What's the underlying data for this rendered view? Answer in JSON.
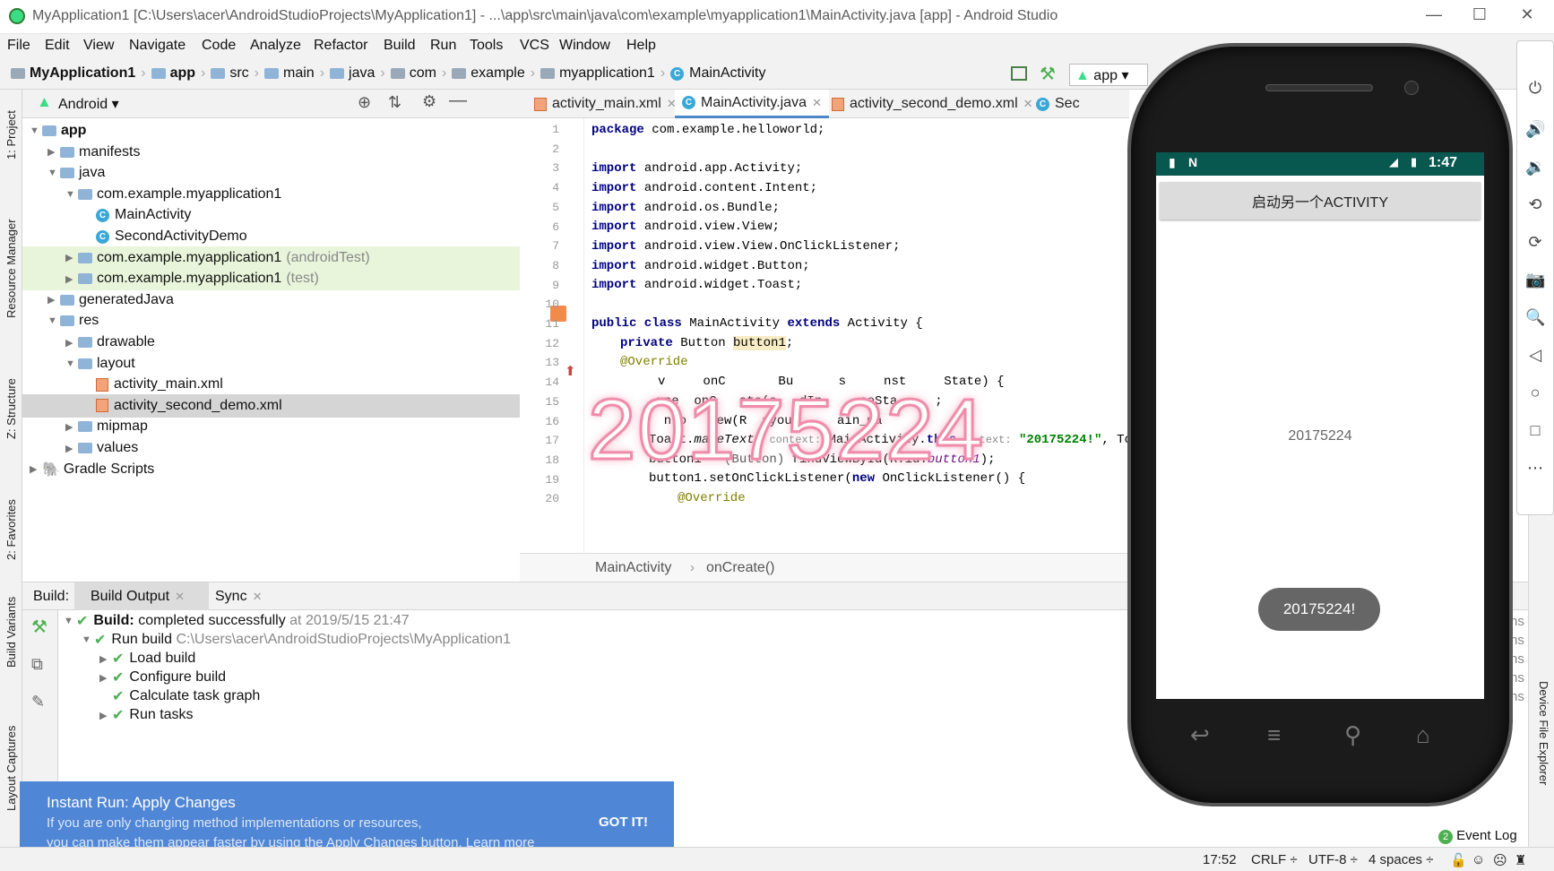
{
  "window": {
    "title": "MyApplication1 [C:\\Users\\acer\\AndroidStudioProjects\\MyApplication1] - ...\\app\\src\\main\\java\\com\\example\\myapplication1\\MainActivity.java [app] - Android Studio",
    "minimize": "—",
    "maximize": "☐",
    "close": "✕"
  },
  "menu": [
    "File",
    "Edit",
    "View",
    "Navigate",
    "Code",
    "Analyze",
    "Refactor",
    "Build",
    "Run",
    "Tools",
    "VCS",
    "Window",
    "Help"
  ],
  "breadcrumb": [
    "MyApplication1",
    "app",
    "src",
    "main",
    "java",
    "com",
    "example",
    "myapplication1",
    "MainActivity"
  ],
  "toolbar": {
    "run_config": "app"
  },
  "left_strip": [
    "1: Project",
    "Resource Manager",
    "Z: Structure",
    "2: Favorites",
    "Build Variants",
    "Layout Captures"
  ],
  "project": {
    "view_selector": "Android",
    "tree": [
      {
        "label": "app",
        "indent": 0,
        "arrow": "▼",
        "bold": true,
        "icon": "folder"
      },
      {
        "label": "manifests",
        "indent": 1,
        "arrow": "▶",
        "icon": "folder"
      },
      {
        "label": "java",
        "indent": 1,
        "arrow": "▼",
        "icon": "folder"
      },
      {
        "label": "com.example.myapplication1",
        "indent": 2,
        "arrow": "▼",
        "icon": "folder"
      },
      {
        "label": "MainActivity",
        "indent": 3,
        "arrow": "",
        "icon": "class"
      },
      {
        "label": "SecondActivityDemo",
        "indent": 3,
        "arrow": "",
        "icon": "class"
      },
      {
        "label": "com.example.myapplication1",
        "suffix": "(androidTest)",
        "indent": 2,
        "arrow": "▶",
        "icon": "folder",
        "hl": "green"
      },
      {
        "label": "com.example.myapplication1",
        "suffix": "(test)",
        "indent": 2,
        "arrow": "▶",
        "icon": "folder",
        "hl": "green"
      },
      {
        "label": "generatedJava",
        "indent": 1,
        "arrow": "▶",
        "icon": "folder"
      },
      {
        "label": "res",
        "indent": 1,
        "arrow": "▼",
        "icon": "folder"
      },
      {
        "label": "drawable",
        "indent": 2,
        "arrow": "▶",
        "icon": "folder"
      },
      {
        "label": "layout",
        "indent": 2,
        "arrow": "▼",
        "icon": "folder"
      },
      {
        "label": "activity_main.xml",
        "indent": 3,
        "arrow": "",
        "icon": "xml"
      },
      {
        "label": "activity_second_demo.xml",
        "indent": 3,
        "arrow": "",
        "icon": "xml",
        "hl": "sel"
      },
      {
        "label": "mipmap",
        "indent": 2,
        "arrow": "▶",
        "icon": "folder"
      },
      {
        "label": "values",
        "indent": 2,
        "arrow": "▶",
        "icon": "folder"
      },
      {
        "label": "Gradle Scripts",
        "indent": 0,
        "arrow": "▶",
        "icon": "gradle"
      }
    ]
  },
  "editor": {
    "tabs": [
      "activity_main.xml",
      "MainActivity.java",
      "activity_second_demo.xml",
      "Sec"
    ],
    "line_numbers": [
      "1",
      "2",
      "3",
      "4",
      "5",
      "6",
      "7",
      "8",
      "9",
      "10",
      "11",
      "12",
      "13",
      "14",
      "15",
      "16",
      "17",
      "18",
      "19",
      "20"
    ],
    "footer": {
      "class": "MainActivity",
      "method": "onCreate()"
    }
  },
  "code": {
    "l1_kw": "package",
    "l1": " com.example.helloworld;",
    "imp": "import",
    "l3": " android.app.Activity;",
    "l4": " android.content.Intent;",
    "l5": " android.os.Bundle;",
    "l6": " android.view.View;",
    "l7": " android.view.View.OnClickListener;",
    "l8": " android.widget.Button;",
    "l9": " android.widget.Toast;",
    "l11_a": "public class",
    "l11_b": " MainActivity ",
    "l11_c": "extends",
    "l11_d": " Activity {",
    "l12_a": "private",
    "l12_b": " Button ",
    "l12_c": "button1",
    "l12_d": ";",
    "l13": "@Override",
    "l14": "     v     onC       Bu      s     nst     State) {",
    "l15": " upe  onC   ate(s   dIn     ceSta     ;",
    "l16": "  nto   iew(R  ayout     ain_ma     ;",
    "l17_a": "Toast.",
    "l17_b": "makeText",
    "l17_c": "(",
    "l17_h1": "context:",
    "l17_d": " MainActivity.",
    "l17_e": "this",
    "l17_f": ",",
    "l17_h2": "text:",
    "l17_s": "\"20175224!\"",
    "l17_g": ", Toast.",
    "l18_a": "button1 = ",
    "l18_b": "(Button)",
    "l18_c": " findViewById(R.id.",
    "l18_d": "button1",
    "l18_e": ");",
    "l19_a": "button1.setOnClickListener(",
    "l19_b": "new",
    "l19_c": " OnClickListener() {",
    "l20": "@Override"
  },
  "watermark": "20175224",
  "build": {
    "label": "Build:",
    "tabs": [
      "Build Output",
      "Sync"
    ],
    "status_bold": "Build:",
    "status_text": "completed successfully",
    "status_time": "at 2019/5/15 21:47",
    "run_label": "Run build",
    "run_path": "C:\\Users\\acer\\AndroidStudioProjects\\MyApplication1",
    "steps": [
      "Load build",
      "Configure build",
      "Calculate task graph",
      "Run tasks"
    ],
    "timings": [
      "ns",
      "ns",
      "ns",
      "ns",
      "ns"
    ]
  },
  "popup": {
    "title": "Instant Run: Apply Changes",
    "line1": "If you are only changing method implementations or resources,",
    "line2": "you can make them appear faster by using the Apply Changes button. Learn more",
    "action": "GOT IT!"
  },
  "status": {
    "event_log": "Event Log",
    "event_count": "2",
    "position": "17:52",
    "line_sep": "CRLF ÷",
    "encoding": "UTF-8 ÷",
    "indent": "4 spaces ÷"
  },
  "right_strip": [
    "Device File Explorer"
  ],
  "emulator": {
    "time": "1:47",
    "button_label": "启动另一个ACTIVITY",
    "text_view": "20175224",
    "toast": "20175224!"
  },
  "colors": {
    "accent": "#4a88c7",
    "popup": "#4f86d6",
    "toolbar_status": "#08584f",
    "watermark": "#f08cab"
  }
}
